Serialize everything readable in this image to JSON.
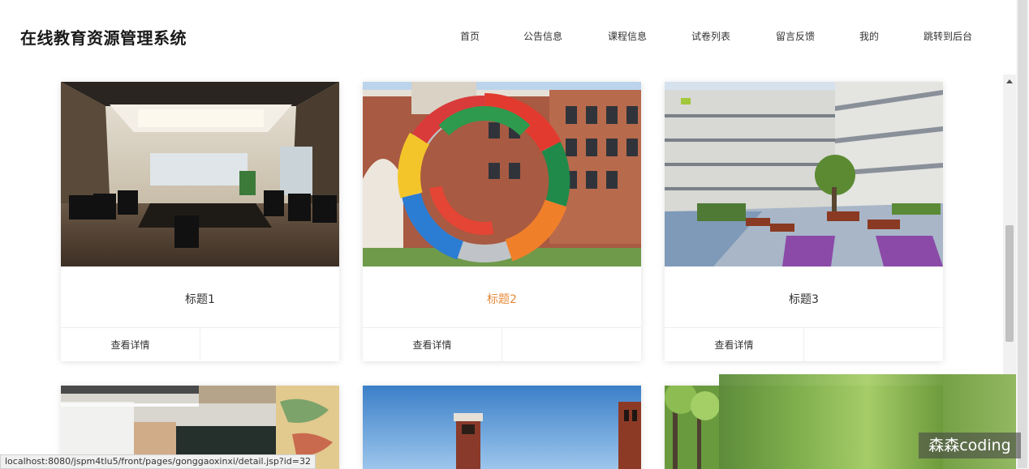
{
  "brand": "在线教育资源管理系统",
  "nav": {
    "items": [
      "首页",
      "公告信息",
      "课程信息",
      "试卷列表",
      "留言反馈",
      "我的",
      "跳转到后台"
    ]
  },
  "cards": [
    {
      "title": "标题1",
      "action": "查看详情"
    },
    {
      "title": "标题2",
      "action": "查看详情"
    },
    {
      "title": "标题3",
      "action": "查看详情"
    }
  ],
  "statusbar": "localhost:8080/jspm4tlu5/front/pages/gonggaoxinxi/detail.jsp?id=32",
  "watermark": "森森coding",
  "colors": {
    "active_title": "#e88a3a",
    "text": "#333333"
  }
}
